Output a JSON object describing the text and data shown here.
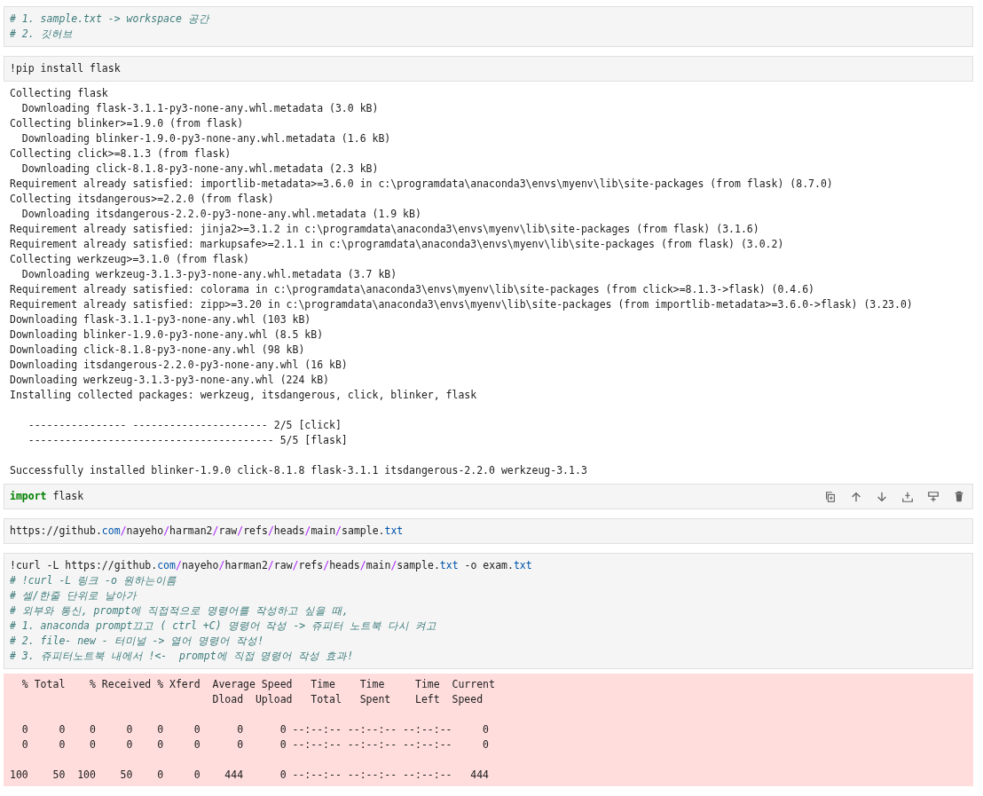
{
  "cells": [
    {
      "kind": "code",
      "active": false,
      "lines": [
        [
          {
            "kind": "comment",
            "text": "# 1. sample.txt -> workspace 공간"
          }
        ],
        [
          {
            "kind": "comment",
            "text": "# 2. 깃허브"
          }
        ]
      ]
    },
    {
      "kind": "code",
      "active": false,
      "lines": [
        [
          {
            "kind": "plain",
            "text": "!pip install flask"
          }
        ]
      ]
    },
    {
      "kind": "stdout",
      "blocks": [
        [
          "Collecting flask",
          "  Downloading flask-3.1.1-py3-none-any.whl.metadata (3.0 kB)",
          "Collecting blinker>=1.9.0 (from flask)",
          "  Downloading blinker-1.9.0-py3-none-any.whl.metadata (1.6 kB)",
          "Collecting click>=8.1.3 (from flask)",
          "  Downloading click-8.1.8-py3-none-any.whl.metadata (2.3 kB)",
          "Requirement already satisfied: importlib-metadata>=3.6.0 in c:\\programdata\\anaconda3\\envs\\myenv\\lib\\site-packages (from flask) (8.7.0)",
          "Collecting itsdangerous>=2.2.0 (from flask)",
          "  Downloading itsdangerous-2.2.0-py3-none-any.whl.metadata (1.9 kB)",
          "Requirement already satisfied: jinja2>=3.1.2 in c:\\programdata\\anaconda3\\envs\\myenv\\lib\\site-packages (from flask) (3.1.6)",
          "Requirement already satisfied: markupsafe>=2.1.1 in c:\\programdata\\anaconda3\\envs\\myenv\\lib\\site-packages (from flask) (3.0.2)",
          "Collecting werkzeug>=3.1.0 (from flask)",
          "  Downloading werkzeug-3.1.3-py3-none-any.whl.metadata (3.7 kB)",
          "Requirement already satisfied: colorama in c:\\programdata\\anaconda3\\envs\\myenv\\lib\\site-packages (from click>=8.1.3->flask) (0.4.6)",
          "Requirement already satisfied: zipp>=3.20 in c:\\programdata\\anaconda3\\envs\\myenv\\lib\\site-packages (from importlib-metadata>=3.6.0->flask) (3.23.0)",
          "Downloading flask-3.1.1-py3-none-any.whl (103 kB)",
          "Downloading blinker-1.9.0-py3-none-any.whl (8.5 kB)",
          "Downloading click-8.1.8-py3-none-any.whl (98 kB)",
          "Downloading itsdangerous-2.2.0-py3-none-any.whl (16 kB)",
          "Downloading werkzeug-3.1.3-py3-none-any.whl (224 kB)",
          "Installing collected packages: werkzeug, itsdangerous, click, blinker, flask"
        ],
        [
          "   ---------------- ---------------------- 2/5 [click]",
          "   ---------------------------------------- 5/5 [flask]"
        ],
        [
          "Successfully installed blinker-1.9.0 click-8.1.8 flask-3.1.1 itsdangerous-2.2.0 werkzeug-3.1.3"
        ]
      ]
    },
    {
      "kind": "code",
      "active": true,
      "lines": [
        [
          {
            "kind": "keyword",
            "text": "import"
          },
          {
            "kind": "plain",
            "text": " flask"
          }
        ]
      ]
    },
    {
      "kind": "code",
      "active": false,
      "lines": [
        [
          {
            "kind": "plain",
            "text": "https://github."
          },
          {
            "kind": "attr",
            "text": "com"
          },
          {
            "kind": "op",
            "text": "/"
          },
          {
            "kind": "plain",
            "text": "nayeho"
          },
          {
            "kind": "op",
            "text": "/"
          },
          {
            "kind": "plain",
            "text": "harman2"
          },
          {
            "kind": "op",
            "text": "/"
          },
          {
            "kind": "plain",
            "text": "raw"
          },
          {
            "kind": "op",
            "text": "/"
          },
          {
            "kind": "plain",
            "text": "refs"
          },
          {
            "kind": "op",
            "text": "/"
          },
          {
            "kind": "plain",
            "text": "heads"
          },
          {
            "kind": "op",
            "text": "/"
          },
          {
            "kind": "plain",
            "text": "main"
          },
          {
            "kind": "op",
            "text": "/"
          },
          {
            "kind": "plain",
            "text": "sample."
          },
          {
            "kind": "attr",
            "text": "txt"
          }
        ]
      ]
    },
    {
      "kind": "code",
      "active": false,
      "lines": [
        [
          {
            "kind": "plain",
            "text": "!curl -L https://github."
          },
          {
            "kind": "attr",
            "text": "com"
          },
          {
            "kind": "op",
            "text": "/"
          },
          {
            "kind": "plain",
            "text": "nayeho"
          },
          {
            "kind": "op",
            "text": "/"
          },
          {
            "kind": "plain",
            "text": "harman2"
          },
          {
            "kind": "op",
            "text": "/"
          },
          {
            "kind": "plain",
            "text": "raw"
          },
          {
            "kind": "op",
            "text": "/"
          },
          {
            "kind": "plain",
            "text": "refs"
          },
          {
            "kind": "op",
            "text": "/"
          },
          {
            "kind": "plain",
            "text": "heads"
          },
          {
            "kind": "op",
            "text": "/"
          },
          {
            "kind": "plain",
            "text": "main"
          },
          {
            "kind": "op",
            "text": "/"
          },
          {
            "kind": "plain",
            "text": "sample."
          },
          {
            "kind": "attr",
            "text": "txt"
          },
          {
            "kind": "plain",
            "text": " -o exam."
          },
          {
            "kind": "attr",
            "text": "txt"
          }
        ],
        [
          {
            "kind": "comment",
            "text": "# !curl -L 링크 -o 원하는이름"
          }
        ],
        [
          {
            "kind": "comment",
            "text": "# 셀/한줄 단위로 날아가"
          }
        ],
        [
          {
            "kind": "comment",
            "text": "# 외부와 통신, prompt에 직접적으로 명령어를 작성하고 싶을 때,"
          }
        ],
        [
          {
            "kind": "comment",
            "text": "# 1. anaconda prompt끄고 ( ctrl +C) 명령어 작성 -> 쥬피터 노트북 다시 켜고"
          }
        ],
        [
          {
            "kind": "comment",
            "text": "# 2. file- new - 터미널 -> 열어 명령어 작성!"
          }
        ],
        [
          {
            "kind": "comment",
            "text": "# 3. 쥬피터노트북 내에서 !<-  prompt에 직접 명령어 작성 효과!"
          }
        ]
      ]
    },
    {
      "kind": "stderr",
      "blocks": [
        [
          "  % Total    % Received % Xferd  Average Speed   Time    Time     Time  Current",
          "                                 Dload  Upload   Total   Spent    Left  Speed"
        ],
        [
          "  0     0    0     0    0     0      0      0 --:--:-- --:--:-- --:--:--     0",
          "  0     0    0     0    0     0      0      0 --:--:-- --:--:-- --:--:--     0"
        ],
        [
          "100    50  100    50    0     0    444      0 --:--:-- --:--:-- --:--:--   444"
        ]
      ]
    }
  ]
}
